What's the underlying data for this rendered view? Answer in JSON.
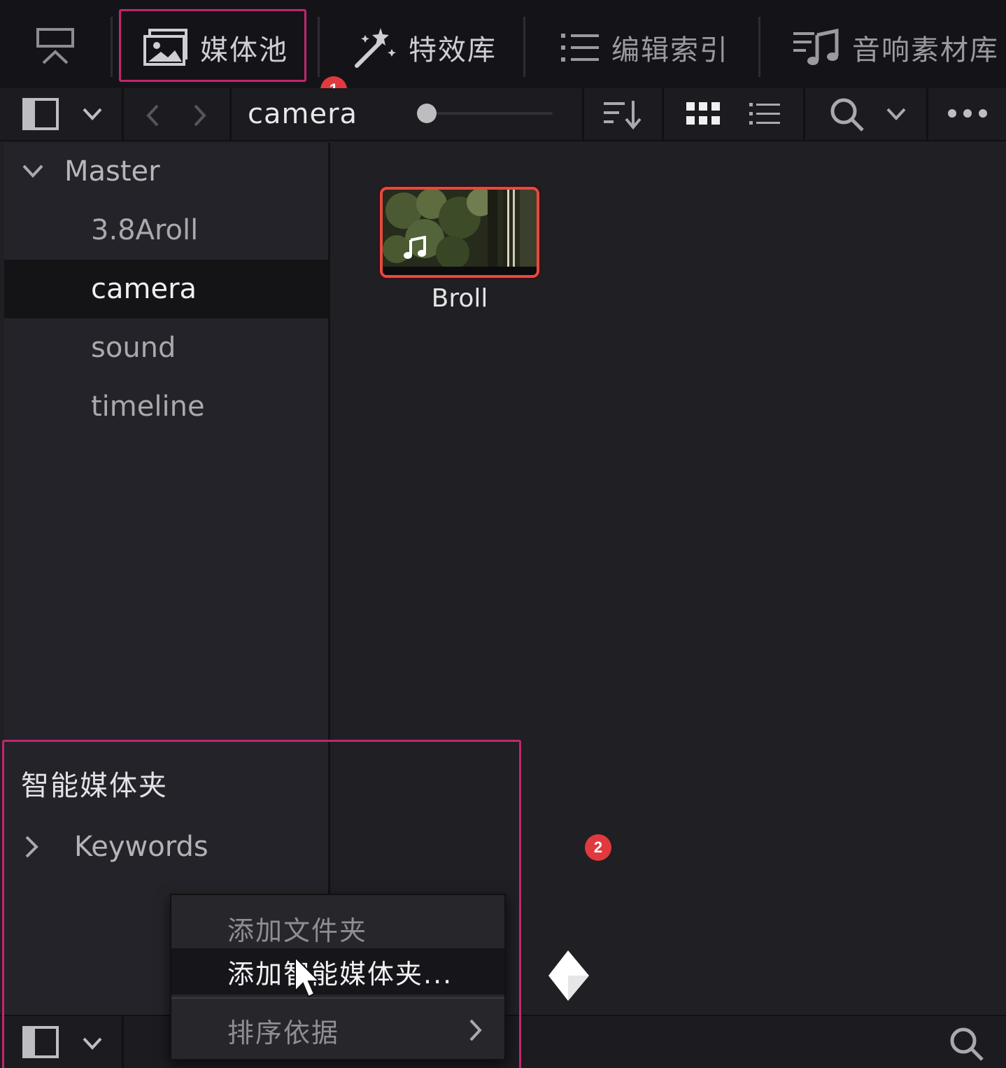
{
  "tabs": [
    {
      "label": "媒体池",
      "icon": "media-pool-icon"
    },
    {
      "label": "特效库",
      "icon": "effects-wand-icon"
    },
    {
      "label": "编辑索引",
      "icon": "edit-index-list-icon"
    },
    {
      "label": "音响素材库",
      "icon": "sound-library-icon"
    }
  ],
  "toolbar": {
    "current_bin": "camera",
    "view_mode": "grid"
  },
  "tree": {
    "root": "Master",
    "bins": [
      "3.8Aroll",
      "camera",
      "sound",
      "timeline"
    ],
    "selected": "camera"
  },
  "clips": [
    {
      "name": "Broll",
      "type": "audio"
    }
  ],
  "smart_bins": {
    "title": "智能媒体夹",
    "items": [
      "Keywords"
    ]
  },
  "context_menu": {
    "items": [
      {
        "label": "添加文件夹",
        "enabled": false
      },
      {
        "label": "添加智能媒体夹...",
        "enabled": true,
        "hovered": true
      },
      {
        "label": "排序依据",
        "enabled": false,
        "submenu": true
      }
    ]
  },
  "annotations": {
    "marker_1": "1",
    "marker_2": "2",
    "highlight_color": "#c2266f",
    "marker_color": "#e03a3e"
  }
}
